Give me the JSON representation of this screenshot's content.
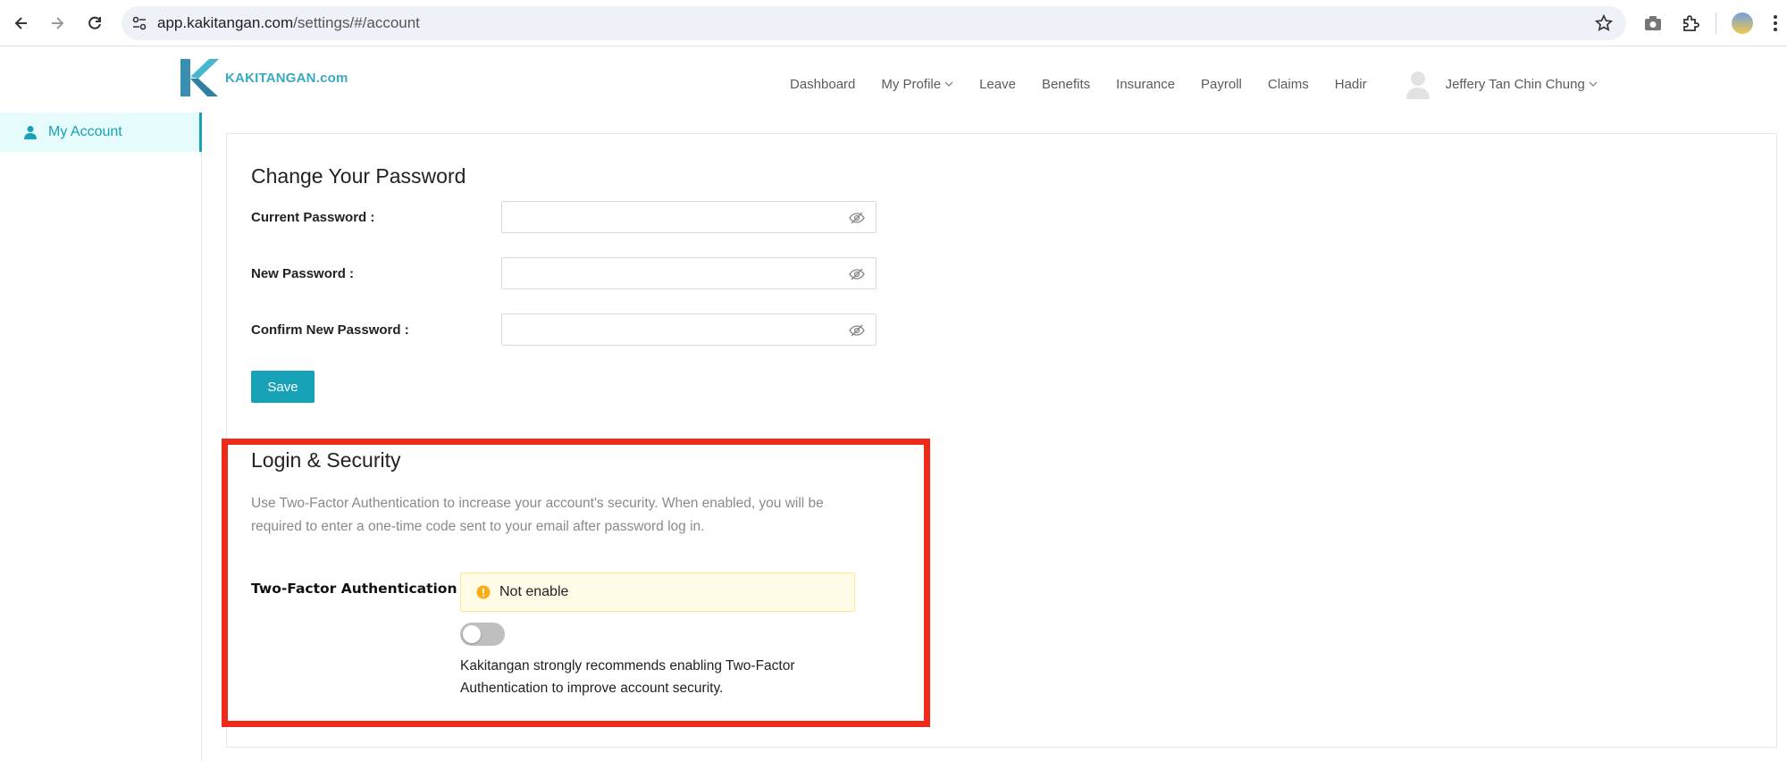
{
  "browser": {
    "url_host": "app.kakitangan.com",
    "url_path": "/settings/#/account"
  },
  "app": {
    "logo_text": "KAKITANGAN.com",
    "nav": [
      {
        "label": "Dashboard"
      },
      {
        "label": "My Profile",
        "has_dropdown": true
      },
      {
        "label": "Leave"
      },
      {
        "label": "Benefits"
      },
      {
        "label": "Insurance"
      },
      {
        "label": "Payroll"
      },
      {
        "label": "Claims"
      },
      {
        "label": "Hadir"
      }
    ],
    "user_name": "Jeffery Tan Chin Chung"
  },
  "sidebar": {
    "items": [
      {
        "label": "My Account",
        "icon": "user-icon",
        "active": true
      }
    ]
  },
  "password_section": {
    "title": "Change Your Password",
    "fields": [
      {
        "label": "Current Password",
        "value": ""
      },
      {
        "label": "New Password",
        "value": ""
      },
      {
        "label": "Confirm New Password",
        "value": ""
      }
    ],
    "save_label": "Save"
  },
  "security_section": {
    "title": "Login & Security",
    "description": "Use Two-Factor Authentication to increase your account's security. When enabled, you will be required to enter a one-time code sent to your email after password log in.",
    "tfa_label": "Two-Factor Authentication",
    "status_text": "Not enable",
    "toggle_on": false,
    "recommendation": "Kakitangan strongly recommends enabling Two-Factor Authentication to improve account security."
  },
  "colors": {
    "accent": "#17a2b8",
    "highlight": "#ee2a1b",
    "warning_bg": "#fffbe6",
    "warning_icon": "#faad14"
  }
}
